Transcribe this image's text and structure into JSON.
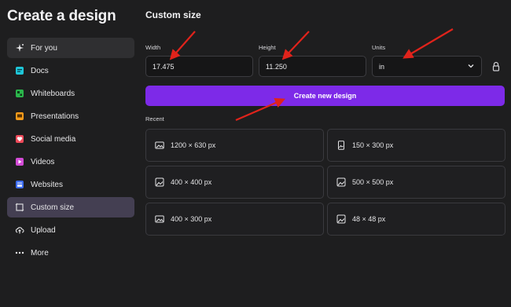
{
  "sidebar": {
    "title": "Create a design",
    "items": [
      {
        "label": "For you",
        "icon": "sparkle-icon",
        "color": "#e8e8ea"
      },
      {
        "label": "Docs",
        "icon": "docs-icon",
        "color": "#1ec6d8"
      },
      {
        "label": "Whiteboards",
        "icon": "whiteboard-icon",
        "color": "#2bb54b"
      },
      {
        "label": "Presentations",
        "icon": "presentation-icon",
        "color": "#f59b1b"
      },
      {
        "label": "Social media",
        "icon": "heart-icon",
        "color": "#f04a5a"
      },
      {
        "label": "Videos",
        "icon": "video-icon",
        "color": "#d34bd6"
      },
      {
        "label": "Websites",
        "icon": "website-icon",
        "color": "#3c6cf0"
      },
      {
        "label": "Custom size",
        "icon": "custom-size-icon",
        "color": "#d8d8dc"
      },
      {
        "label": "Upload",
        "icon": "upload-cloud-icon",
        "color": "#e8e8ea"
      },
      {
        "label": "More",
        "icon": "more-dots-icon",
        "color": "#e8e8ea"
      }
    ]
  },
  "main": {
    "title": "Custom size",
    "width_label": "Width",
    "width_value": "17.475",
    "height_label": "Height",
    "height_value": "11.250",
    "units_label": "Units",
    "units_value": "in",
    "create_button": "Create new design",
    "recent_label": "Recent",
    "recent": [
      {
        "label": "1200 × 630 px",
        "icon": "landscape-image-icon"
      },
      {
        "label": "150 × 300 px",
        "icon": "portrait-image-icon"
      },
      {
        "label": "400 × 400 px",
        "icon": "image-icon"
      },
      {
        "label": "500 × 500 px",
        "icon": "image-icon"
      },
      {
        "label": "400 × 300 px",
        "icon": "landscape-image-icon"
      },
      {
        "label": "48 × 48 px",
        "icon": "image-icon"
      }
    ]
  },
  "colors": {
    "accent": "#7d2ae8",
    "annotation_arrow": "#e0231b",
    "active_nav": "#443f52"
  }
}
